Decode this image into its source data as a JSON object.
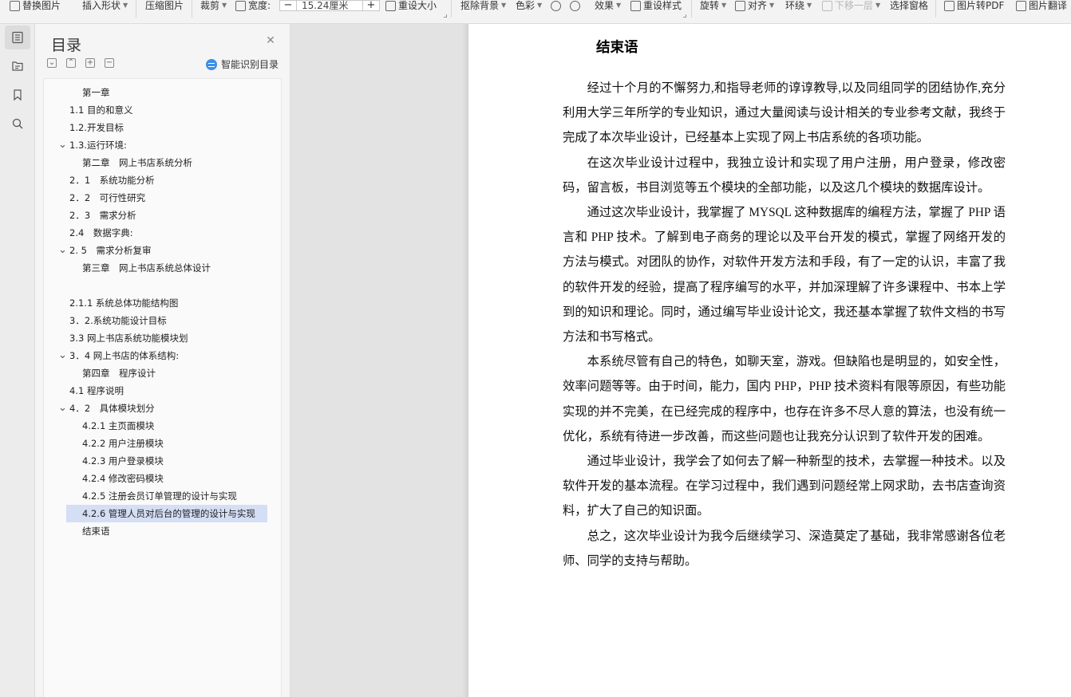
{
  "toolbar": {
    "replace_image": "替换图片",
    "insert_shape": "插入形状",
    "compress_image": "压缩图片",
    "crop": "裁剪",
    "width_label": "宽度:",
    "width_minus": "−",
    "width_value": "15.24厘米",
    "width_plus": "+",
    "reset_size": "重设大小",
    "remove_bg": "抠除背景",
    "color": "色彩",
    "effects": "效果",
    "reset_style": "重设样式",
    "rotate": "旋转",
    "align": "对齐",
    "wrap": "环绕",
    "move_down": "下移一层",
    "selection_pane": "选择窗格",
    "image_to_pdf": "图片转PDF",
    "image_translate": "图片翻译"
  },
  "toc": {
    "title": "目录",
    "ai_toc_label": "智能识别目录",
    "items": [
      {
        "text": "第一章",
        "level": 1,
        "chevron": false,
        "selected": false
      },
      {
        "text": "1.1 目的和意义",
        "level": 0,
        "chevron": false,
        "selected": false
      },
      {
        "text": "1.2.开发目标",
        "level": 0,
        "chevron": false,
        "selected": false
      },
      {
        "text": "1.3.运行环境:",
        "level": 0,
        "chevron": true,
        "selected": false
      },
      {
        "text": "第二章　网上书店系统分析",
        "level": 1,
        "chevron": false,
        "selected": false
      },
      {
        "text": "2．1　系统功能分析",
        "level": 0,
        "chevron": false,
        "selected": false
      },
      {
        "text": "2．2　可行性研究",
        "level": 0,
        "chevron": false,
        "selected": false
      },
      {
        "text": "2．3　需求分析",
        "level": 0,
        "chevron": false,
        "selected": false
      },
      {
        "text": "2.4　数据字典:",
        "level": 0,
        "chevron": false,
        "selected": false
      },
      {
        "text": "2. 5　需求分析复审",
        "level": 0,
        "chevron": true,
        "selected": false
      },
      {
        "text": "第三章　网上书店系统总体设计",
        "level": 1,
        "chevron": false,
        "selected": false
      },
      {
        "text": "",
        "level": 1,
        "chevron": false,
        "selected": false
      },
      {
        "text": "2.1.1  系统总体功能结构图",
        "level": 0,
        "chevron": false,
        "selected": false
      },
      {
        "text": "3．2.系统功能设计目标",
        "level": 0,
        "chevron": false,
        "selected": false
      },
      {
        "text": "3.3  网上书店系统功能模块划",
        "level": 0,
        "chevron": false,
        "selected": false
      },
      {
        "text": "3．4  网上书店的体系结构:",
        "level": 0,
        "chevron": true,
        "selected": false
      },
      {
        "text": "第四章　程序设计",
        "level": 1,
        "chevron": false,
        "selected": false
      },
      {
        "text": "4.1 程序说明",
        "level": 0,
        "chevron": false,
        "selected": false
      },
      {
        "text": "4．2　具体模块划分",
        "level": 0,
        "chevron": true,
        "selected": false
      },
      {
        "text": "4.2.1 主页面模块",
        "level": 1,
        "chevron": false,
        "selected": false
      },
      {
        "text": "4.2.2  用户注册模块",
        "level": 1,
        "chevron": false,
        "selected": false
      },
      {
        "text": "4.2.3  用户登录模块",
        "level": 1,
        "chevron": false,
        "selected": false
      },
      {
        "text": "4.2.4 修改密码模块",
        "level": 1,
        "chevron": false,
        "selected": false
      },
      {
        "text": "4.2.5 注册会员订单管理的设计与实现",
        "level": 1,
        "chevron": false,
        "selected": false
      },
      {
        "text": "4.2.6 管理人员对后台的管理的设计与实现",
        "level": 1,
        "chevron": false,
        "selected": true
      },
      {
        "text": "结束语",
        "level": 1,
        "chevron": false,
        "selected": false
      }
    ]
  },
  "document": {
    "title": "结束语",
    "paragraphs": [
      "经过十个月的不懈努力,和指导老师的谆谆教导,以及同组同学的团结协作,充分利用大学三年所学的专业知识，通过大量阅读与设计相关的专业参考文献，我终于完成了本次毕业设计，已经基本上实现了网上书店系统的各项功能。",
      "在这次毕业设计过程中，我独立设计和实现了用户注册，用户登录，修改密码，留言板，书目浏览等五个模块的全部功能，以及这几个模块的数据库设计。",
      "通过这次毕业设计，我掌握了 MYSQL 这种数据库的编程方法，掌握了 PHP 语言和 PHP 技术。了解到电子商务的理论以及平台开发的模式，掌握了网络开发的方法与模式。对团队的协作，对软件开发方法和手段，有了一定的认识，丰富了我的软件开发的经验，提高了程序编写的水平，并加深理解了许多课程中、书本上学到的知识和理论。同时，通过编写毕业设计论文，我还基本掌握了软件文档的书写方法和书写格式。",
      "本系统尽管有自己的特色，如聊天室，游戏。但缺陷也是明显的，如安全性，效率问题等等。由于时间，能力，国内 PHP，PHP 技术资料有限等原因，有些功能实现的并不完美，在已经完成的程序中，也存在许多不尽人意的算法，也没有统一优化，系统有待进一步改善，而这些问题也让我充分认识到了软件开发的困难。",
      "通过毕业设计，我学会了如何去了解一种新型的技术，去掌握一种技术。以及软件开发的基本流程。在学习过程中，我们遇到问题经常上网求助，去书店查询资料，扩大了自己的知识面。",
      "总之，这次毕业设计为我今后继续学习、深造莫定了基础，我非常感谢各位老师、同学的支持与帮助。"
    ]
  },
  "colors": {
    "accent": "#3c8fe8",
    "selected_bg": "#d4dff5"
  }
}
